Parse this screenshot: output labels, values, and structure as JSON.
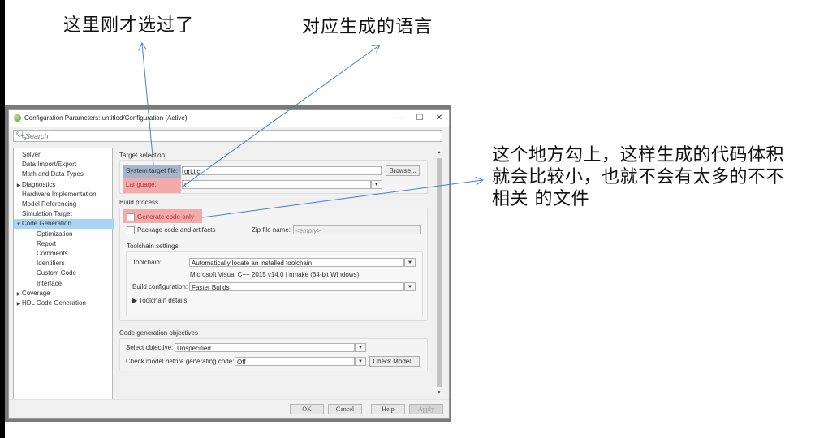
{
  "annotations": {
    "top_left": "这里刚才选过了",
    "top_right": "对应生成的语言",
    "right": "这个地方勾上，这样生成的代码体积就会比较小，也就不会有太多的不不相关 的文件"
  },
  "window": {
    "title": "Configuration Parameters: untitled/Configuration (Active)",
    "controls": {
      "minimize": "—",
      "maximize": "☐",
      "close": "✕"
    }
  },
  "search": {
    "placeholder": "Search",
    "icon": "search-icon"
  },
  "tree": {
    "items": [
      {
        "label": "Solver",
        "level": 0,
        "expander": ""
      },
      {
        "label": "Data Import/Export",
        "level": 0,
        "expander": ""
      },
      {
        "label": "Math and Data Types",
        "level": 0,
        "expander": ""
      },
      {
        "label": "Diagnostics",
        "level": 0,
        "expander": "▶"
      },
      {
        "label": "Hardware Implementation",
        "level": 0,
        "expander": ""
      },
      {
        "label": "Model Referencing",
        "level": 0,
        "expander": ""
      },
      {
        "label": "Simulation Target",
        "level": 0,
        "expander": ""
      },
      {
        "label": "Code Generation",
        "level": 0,
        "expander": "▼",
        "selected": true
      },
      {
        "label": "Optimization",
        "level": 1,
        "expander": ""
      },
      {
        "label": "Report",
        "level": 1,
        "expander": ""
      },
      {
        "label": "Comments",
        "level": 1,
        "expander": ""
      },
      {
        "label": "Identifiers",
        "level": 1,
        "expander": ""
      },
      {
        "label": "Custom Code",
        "level": 1,
        "expander": ""
      },
      {
        "label": "Interface",
        "level": 1,
        "expander": ""
      },
      {
        "label": "Coverage",
        "level": 0,
        "expander": "▶"
      },
      {
        "label": "HDL Code Generation",
        "level": 0,
        "expander": "▶"
      }
    ]
  },
  "target_selection": {
    "title": "Target selection",
    "system_target_file_label": "System target file:",
    "system_target_file_value": "grt.tlc",
    "browse_label": "Browse...",
    "language_label": "Language:",
    "language_value": "C"
  },
  "build_process": {
    "title": "Build process",
    "generate_code_only_label": "Generate code only",
    "generate_code_only_checked": false,
    "package_label": "Package code and artifacts",
    "package_checked": false,
    "zip_label": "Zip file name:",
    "zip_placeholder": "<empty>"
  },
  "toolchain": {
    "title": "Toolchain settings",
    "toolchain_label": "Toolchain:",
    "toolchain_value": "Automatically locate an installed toolchain",
    "toolchain_info": "Microsoft Visual C++ 2015 v14.0 | nmake (64-bit Windows)",
    "build_config_label": "Build configuration:",
    "build_config_value": "Faster Builds",
    "details_label": "▶ Toolchain details"
  },
  "objectives": {
    "title": "Code generation objectives",
    "select_label": "Select objective:",
    "select_value": "Unspecified",
    "check_label": "Check model before generating code:",
    "check_value": "Off",
    "check_button": "Check Model..."
  },
  "ellipsis": "...",
  "footer": {
    "ok": "OK",
    "cancel": "Cancel",
    "help": "Help",
    "apply": "Apply"
  },
  "colors": {
    "selection": "#a8d5f3",
    "arrow": "#4a7fc0",
    "highlight_blue": "#8da2bf",
    "highlight_red": "#f78e8e"
  }
}
